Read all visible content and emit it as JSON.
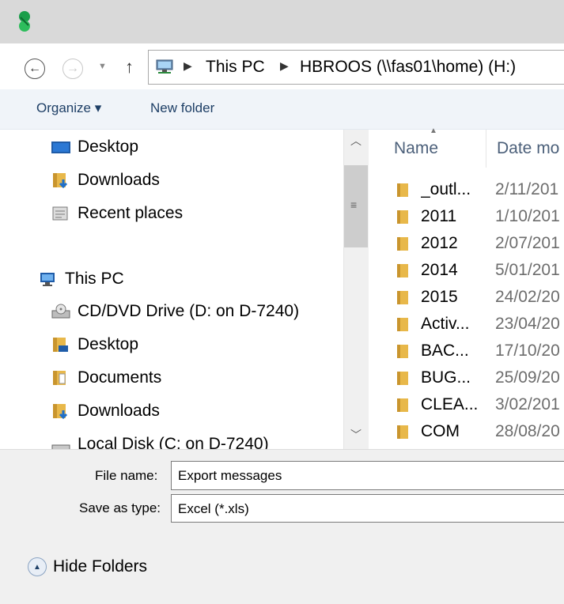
{
  "navigation": {
    "back_icon": "back-arrow-icon",
    "forward_icon": "forward-arrow-icon",
    "up_icon": "up-arrow-icon",
    "address": {
      "segment1": "This PC",
      "segment2": "HBROOS (\\\\fas01\\home) (H:)"
    }
  },
  "toolbar": {
    "organize_label": "Organize ▾",
    "new_folder_label": "New folder"
  },
  "navpane": {
    "items": [
      {
        "label": "Desktop",
        "icon": "desktop-icon"
      },
      {
        "label": "Downloads",
        "icon": "downloads-folder-icon"
      },
      {
        "label": "Recent places",
        "icon": "recent-places-icon"
      },
      {
        "label": "This PC",
        "icon": "computer-icon"
      },
      {
        "label": "CD/DVD Drive (D: on D-7240)",
        "icon": "cd-drive-icon"
      },
      {
        "label": "Desktop",
        "icon": "desktop-folder-icon"
      },
      {
        "label": "Documents",
        "icon": "documents-folder-icon"
      },
      {
        "label": "Downloads",
        "icon": "downloads-folder-icon"
      },
      {
        "label": "Local Disk (C: on D-7240)",
        "icon": "local-disk-icon"
      }
    ]
  },
  "filelist": {
    "columns": {
      "name": "Name",
      "date": "Date mo"
    },
    "rows": [
      {
        "name": "_outl...",
        "date": "2/11/201"
      },
      {
        "name": "2011",
        "date": "1/10/201"
      },
      {
        "name": "2012",
        "date": "2/07/201"
      },
      {
        "name": "2014",
        "date": "5/01/201"
      },
      {
        "name": "2015",
        "date": "24/02/20"
      },
      {
        "name": "Activ...",
        "date": "23/04/20"
      },
      {
        "name": "BAC...",
        "date": "17/10/20"
      },
      {
        "name": "BUG...",
        "date": "25/09/20"
      },
      {
        "name": "CLEA...",
        "date": "3/02/201"
      },
      {
        "name": "COM",
        "date": "28/08/20"
      }
    ]
  },
  "save": {
    "filename_label": "File name:",
    "filename_value": "Export messages",
    "type_label": "Save as type:",
    "type_value": "Excel (*.xls)"
  },
  "footer": {
    "hide_folders_label": "Hide Folders"
  },
  "colors": {
    "titlebar": "#d9d9d9",
    "toolbar": "#f0f4f9",
    "accent_text": "#1e3f66",
    "folder": "#e8b84a"
  }
}
